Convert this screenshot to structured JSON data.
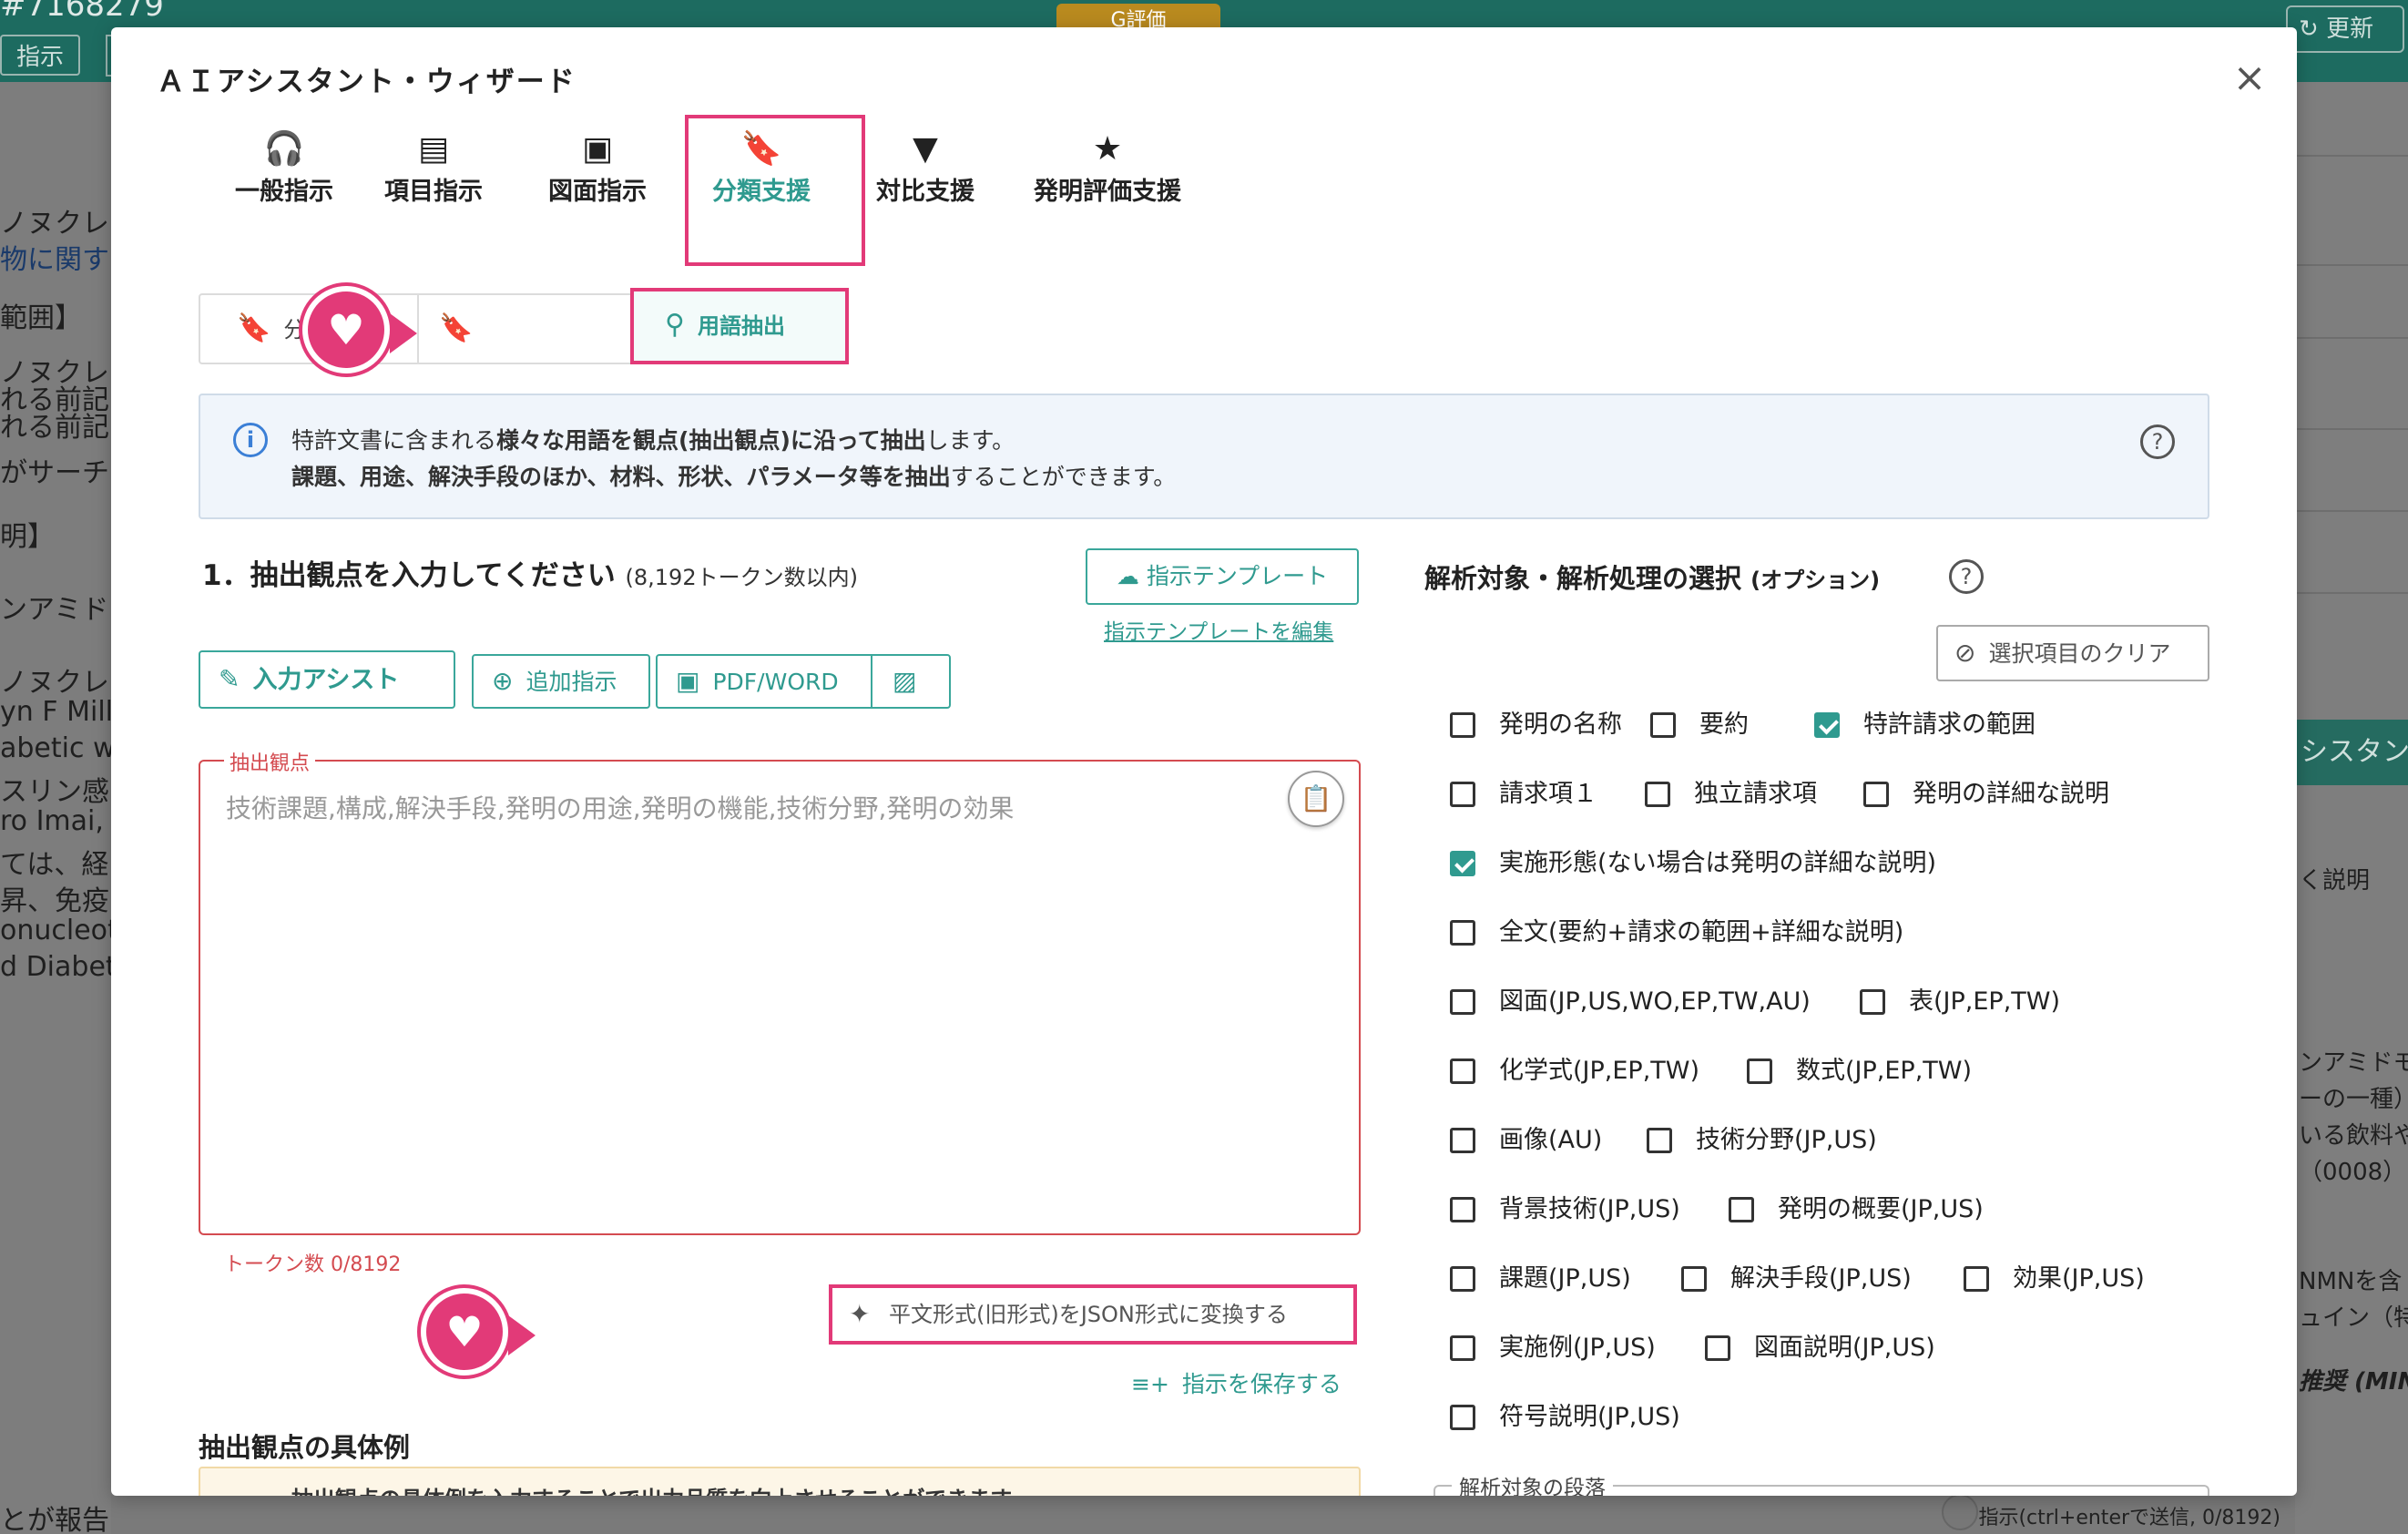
{
  "background": {
    "doc_id": "#7168279",
    "instruct_btn": "指示",
    "g_eval": "G評価",
    "refresh": "更新",
    "left_lines": [
      "ノヌクレ",
      "物に関す",
      "範囲】",
      "ノヌクレ",
      "れる前記",
      "れる前記",
      "がサーチ",
      "明】",
      "ンアミド",
      "ノヌクレ",
      "yn F Mills",
      "abetic w",
      "スリン感",
      "ro Imai, L",
      "ては、経",
      "昇、免疫",
      "onucleot",
      "d Diabete",
      "とが報告されている。"
    ],
    "right_lines": [
      "シスタント",
      "く説明",
      "ンアミドモ",
      "ーの一種）",
      "いる飲料や",
      "（0008）",
      "NMNを含",
      "ュイン（特",
      "推奨 (MIN"
    ],
    "bottom_hint": "指示(ctrl+enterで送信, 0/8192)"
  },
  "modal": {
    "title": "ＡＩアシスタント・ウィザード",
    "close_icon": "×"
  },
  "tabs": [
    {
      "name": "tab-general",
      "label": "一般指示",
      "icon": "headset-icon",
      "glyph": "🎧"
    },
    {
      "name": "tab-items",
      "label": "項目指示",
      "icon": "list-icon",
      "glyph": "▤"
    },
    {
      "name": "tab-figures",
      "label": "図面指示",
      "icon": "image-icon",
      "glyph": "▣"
    },
    {
      "name": "tab-classification",
      "label": "分類支援",
      "icon": "bookmarks-icon",
      "glyph": "🔖",
      "active": true
    },
    {
      "name": "tab-comparison",
      "label": "対比支援",
      "icon": "filter-icon",
      "glyph": "▼"
    },
    {
      "name": "tab-evaluation",
      "label": "発明評価支援",
      "icon": "star-icon",
      "glyph": "★"
    }
  ],
  "subtabs": {
    "expand": "分類展開",
    "term_extract": "用語抽出"
  },
  "info": {
    "line1_a": "特許文書に含まれる",
    "line1_b": "様々な用語を観点(抽出観点)に沿って抽出",
    "line1_c": "します。",
    "line2_a": "課題、用途、解決手段のほか、材料、形状、パラメータ等を抽出",
    "line2_b": "することができます。"
  },
  "step1": {
    "title": "1．抽出観点を入力してください",
    "note": "(8,192トークン数以内)",
    "template_btn": "指示テンプレート",
    "template_edit": "指示テンプレートを編集",
    "input_assist": "入力アシスト",
    "add_instruction": "追加指示",
    "pdf_word": "PDF/WORD",
    "field_label": "抽出観点",
    "placeholder": "技術課題,構成,解決手段,発明の用途,発明の機能,技術分野,発明の効果",
    "token_count": "トークン数 0/8192",
    "convert": "平文形式(旧形式)をJSON形式に変換する",
    "save": "指示を保存する",
    "examples_title": "抽出観点の具体例",
    "examples_text": "抽出観点の具体例を入力することで出力品質を向上させることができます。"
  },
  "options": {
    "title": "解析対象・解析処理の選択",
    "title_small": "(オプション)",
    "clear": "選択項目のクリア",
    "checkboxes": [
      {
        "name": "cb-invention-name",
        "label": "発明の名称",
        "checked": false
      },
      {
        "name": "cb-abstract",
        "label": "要約",
        "checked": false
      },
      {
        "name": "cb-claims",
        "label": "特許請求の範囲",
        "checked": true
      },
      {
        "name": "cb-claim1",
        "label": "請求項１",
        "checked": false
      },
      {
        "name": "cb-independent-claims",
        "label": "独立請求項",
        "checked": false
      },
      {
        "name": "cb-detailed-desc",
        "label": "発明の詳細な説明",
        "checked": false
      },
      {
        "name": "cb-embodiment",
        "label": "実施形態(ない場合は発明の詳細な説明)",
        "checked": true
      },
      {
        "name": "cb-fulltext",
        "label": "全文(要約+請求の範囲+詳細な説明)",
        "checked": false
      },
      {
        "name": "cb-drawings",
        "label": "図面(JP,US,WO,EP,TW,AU)",
        "checked": false
      },
      {
        "name": "cb-tables",
        "label": "表(JP,EP,TW)",
        "checked": false
      },
      {
        "name": "cb-chem",
        "label": "化学式(JP,EP,TW)",
        "checked": false
      },
      {
        "name": "cb-math",
        "label": "数式(JP,EP,TW)",
        "checked": false
      },
      {
        "name": "cb-images",
        "label": "画像(AU)",
        "checked": false
      },
      {
        "name": "cb-tech-field",
        "label": "技術分野(JP,US)",
        "checked": false
      },
      {
        "name": "cb-background",
        "label": "背景技術(JP,US)",
        "checked": false
      },
      {
        "name": "cb-summary",
        "label": "発明の概要(JP,US)",
        "checked": false
      },
      {
        "name": "cb-problem",
        "label": "課題(JP,US)",
        "checked": false
      },
      {
        "name": "cb-solution",
        "label": "解決手段(JP,US)",
        "checked": false
      },
      {
        "name": "cb-effect",
        "label": "効果(JP,US)",
        "checked": false
      },
      {
        "name": "cb-examples",
        "label": "実施例(JP,US)",
        "checked": false
      },
      {
        "name": "cb-fig-desc",
        "label": "図面説明(JP,US)",
        "checked": false
      },
      {
        "name": "cb-ref-signs",
        "label": "符号説明(JP,US)",
        "checked": false
      }
    ],
    "paragraph_label": "解析対象の段落"
  },
  "colors": {
    "accent": "#2f9a8f",
    "highlight": "#e23a78",
    "error": "#d44b50"
  }
}
